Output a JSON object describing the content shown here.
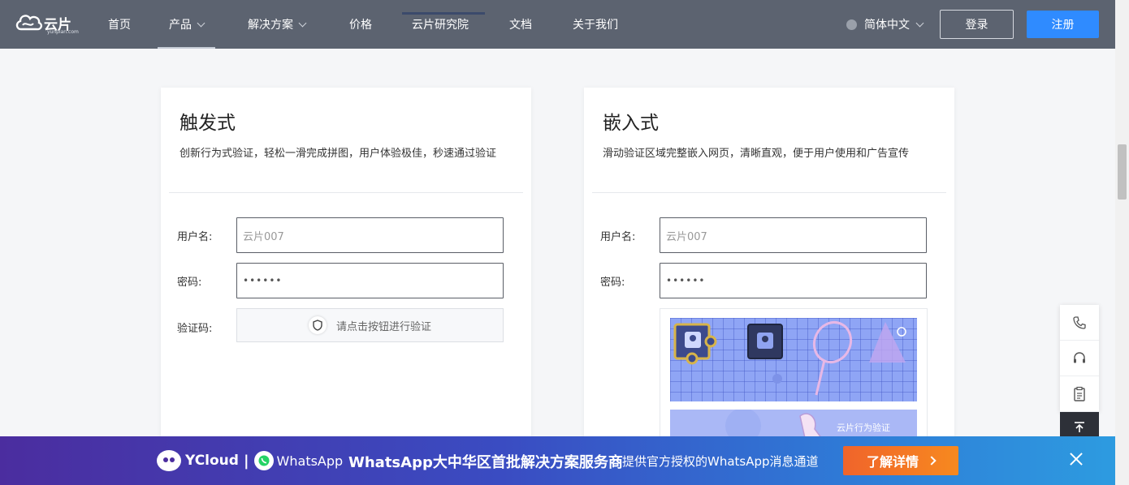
{
  "header": {
    "logo_text": "云片",
    "logo_sub": "yunpian.com",
    "nav": [
      {
        "label": "首页"
      },
      {
        "label": "产品"
      },
      {
        "label": "解决方案"
      },
      {
        "label": "价格"
      },
      {
        "label": "云片研究院"
      },
      {
        "label": "文档"
      },
      {
        "label": "关于我们"
      }
    ],
    "language": "简体中文",
    "login": "登录",
    "register": "注册"
  },
  "cards": [
    {
      "title": "触发式",
      "desc": "创新行为式验证，轻松一滑完成拼图，用户体验极佳，秒速通过验证",
      "username_label": "用户名:",
      "username_placeholder": "云片007",
      "password_label": "密码:",
      "password_value": "••••••",
      "captcha_label": "验证码:",
      "captcha_button": "请点击按钮进行验证"
    },
    {
      "title": "嵌入式",
      "desc": "滑动验证区域完整嵌入网页，清晰直观，便于用户使用和广告宣传",
      "username_label": "用户名:",
      "username_placeholder": "云片007",
      "password_label": "密码:",
      "password_value": "••••••",
      "strip_text": "云片行为验证"
    }
  ],
  "side_tools": [
    "phone-icon",
    "headset-icon",
    "clipboard-icon",
    "back-to-top-icon"
  ],
  "banner": {
    "brand": "YCloud",
    "partner": "WhatsApp",
    "headline": "WhatsApp大中华区首批解决方案服务商",
    "subline": "提供官方授权的WhatsApp消息通道",
    "cta": "了解详情",
    "colors": {
      "start": "#4b2d9f",
      "end": "#2d9be0",
      "cta": "#f0642b"
    }
  }
}
